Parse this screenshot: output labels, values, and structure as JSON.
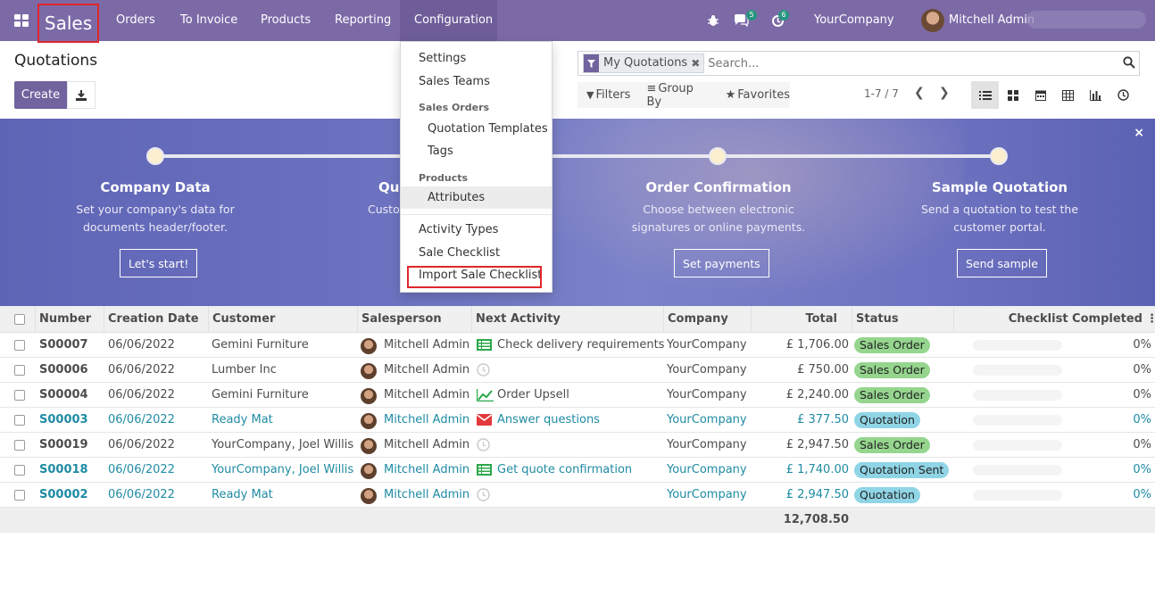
{
  "navbar": {
    "brand": "Sales",
    "menu": [
      "Orders",
      "To Invoice",
      "Products",
      "Reporting",
      "Configuration"
    ],
    "chat_badge": "5",
    "activity_badge": "6",
    "company": "YourCompany",
    "user": "Mitchell Admin"
  },
  "control": {
    "title": "Quotations",
    "create_label": "Create",
    "facet_label": "My Quotations",
    "search_placeholder": "Search...",
    "filters_label": "Filters",
    "groupby_label": "Group By",
    "favorites_label": "Favorites",
    "pager": "1-7 / 7"
  },
  "dropdown": {
    "items": [
      {
        "label": "Settings"
      },
      {
        "label": "Sales Teams"
      }
    ],
    "header_sales_orders": "Sales Orders",
    "sales_orders_items": [
      {
        "label": "Quotation Templates"
      },
      {
        "label": "Tags"
      }
    ],
    "header_products": "Products",
    "products_items": [
      {
        "label": "Attributes"
      }
    ],
    "other_items": [
      {
        "label": "Activity Types"
      },
      {
        "label": "Sale Checklist"
      },
      {
        "label": "Import Sale Checklist"
      }
    ]
  },
  "banner": {
    "steps": [
      {
        "title": "Company Data",
        "desc1": "Set your company's data for",
        "desc2": "documents header/footer.",
        "button": "Let's start!"
      },
      {
        "title": "Qu",
        "desc1": "Custo",
        "desc2": "",
        "button": ""
      },
      {
        "title": "Order Confirmation",
        "desc1": "Choose between electronic",
        "desc2": "signatures or online payments.",
        "button": "Set payments"
      },
      {
        "title": "Sample Quotation",
        "desc1": "Send a quotation to test the",
        "desc2": "customer portal.",
        "button": "Send sample"
      }
    ],
    "close": "×"
  },
  "table": {
    "columns": [
      "Number",
      "Creation Date",
      "Customer",
      "Salesperson",
      "Next Activity",
      "Company",
      "Total",
      "Status",
      "Checklist Completed"
    ],
    "rows": [
      {
        "number": "S00007",
        "date": "06/06/2022",
        "customer": "Gemini Furniture",
        "salesperson": "Mitchell Admin",
        "activity": "Check delivery requirements",
        "activity_icon": "task-list-icon",
        "company": "YourCompany",
        "total": "£ 1,706.00",
        "status": "Sales Order",
        "status_type": "so",
        "checklist": "0%",
        "highlight": false
      },
      {
        "number": "S00006",
        "date": "06/06/2022",
        "customer": "Lumber Inc",
        "salesperson": "Mitchell Admin",
        "activity": "",
        "activity_icon": "clock-icon",
        "company": "YourCompany",
        "total": "£ 750.00",
        "status": "Sales Order",
        "status_type": "so",
        "checklist": "0%",
        "highlight": false
      },
      {
        "number": "S00004",
        "date": "06/06/2022",
        "customer": "Gemini Furniture",
        "salesperson": "Mitchell Admin",
        "activity": "Order Upsell",
        "activity_icon": "chart-line-icon",
        "company": "YourCompany",
        "total": "£ 2,240.00",
        "status": "Sales Order",
        "status_type": "so",
        "checklist": "0%",
        "highlight": false
      },
      {
        "number": "S00003",
        "date": "06/06/2022",
        "customer": "Ready Mat",
        "salesperson": "Mitchell Admin",
        "activity": "Answer questions",
        "activity_icon": "envelope-icon",
        "company": "YourCompany",
        "total": "£ 377.50",
        "status": "Quotation",
        "status_type": "q",
        "checklist": "0%",
        "highlight": true
      },
      {
        "number": "S00019",
        "date": "06/06/2022",
        "customer": "YourCompany, Joel Willis",
        "salesperson": "Mitchell Admin",
        "activity": "",
        "activity_icon": "clock-icon",
        "company": "YourCompany",
        "total": "£ 2,947.50",
        "status": "Sales Order",
        "status_type": "so",
        "checklist": "0%",
        "highlight": false
      },
      {
        "number": "S00018",
        "date": "06/06/2022",
        "customer": "YourCompany, Joel Willis",
        "salesperson": "Mitchell Admin",
        "activity": "Get quote confirmation",
        "activity_icon": "task-list-icon",
        "company": "YourCompany",
        "total": "£ 1,740.00",
        "status": "Quotation Sent",
        "status_type": "qs",
        "checklist": "0%",
        "highlight": true
      },
      {
        "number": "S00002",
        "date": "06/06/2022",
        "customer": "Ready Mat",
        "salesperson": "Mitchell Admin",
        "activity": "",
        "activity_icon": "clock-icon",
        "company": "YourCompany",
        "total": "£ 2,947.50",
        "status": "Quotation",
        "status_type": "q",
        "checklist": "0%",
        "highlight": true
      }
    ],
    "grand_total": "12,708.50"
  },
  "colors": {
    "navbar": "#7c6aa7",
    "primary": "#71639e",
    "link": "#1f8ba3",
    "highlight_border": "#e0262b",
    "status_sales_order": "#95d58e",
    "status_quotation": "#8fd5e6"
  }
}
